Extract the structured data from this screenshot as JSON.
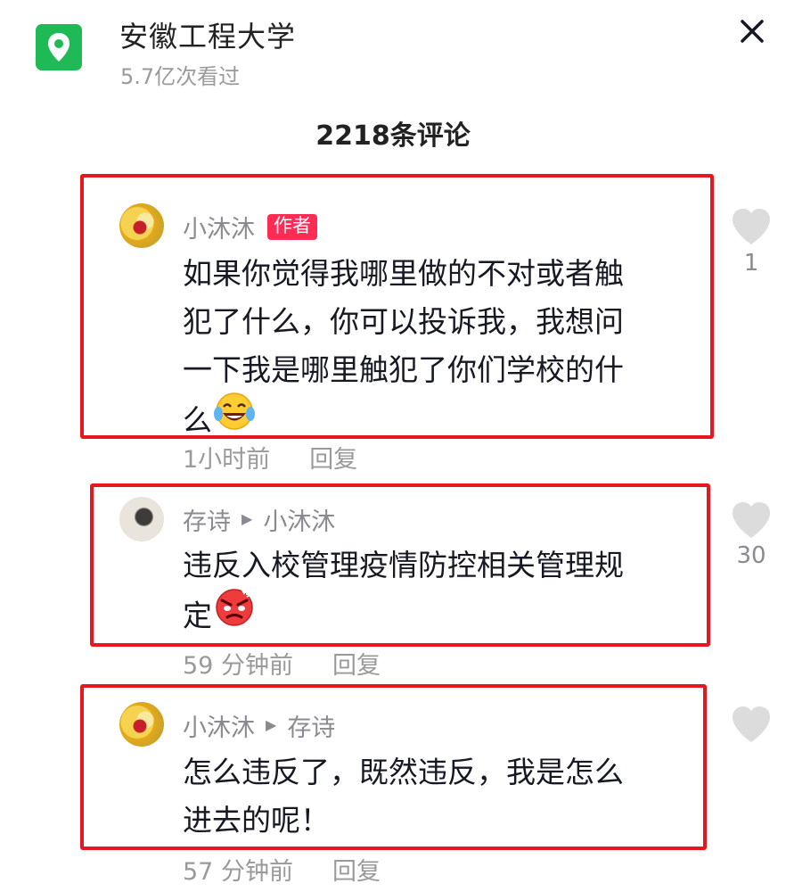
{
  "header": {
    "location_title": "安徽工程大学",
    "views_text": "5.7亿次看过",
    "close_icon": "close-icon",
    "location_icon": "location-pin-icon",
    "accent_color": "#1fb955"
  },
  "comments_header": {
    "count_label": "2218条评论"
  },
  "comments": [
    {
      "author": "小沐沐",
      "badge": "作者",
      "reply_to": "",
      "text_lines": [
        "如果你觉得我哪里做的不对或者触",
        "犯了什么，你可以投诉我，我想问",
        "一下我是哪里触犯了你们学校的什",
        "么"
      ],
      "emoji": "laughing-crying-emoji",
      "time": "1小时前",
      "reply_label": "回复",
      "likes": "1"
    },
    {
      "author": "存诗",
      "badge": "",
      "reply_to": "小沐沐",
      "text_lines": [
        "违反入校管理疫情防控相关管理规",
        "定"
      ],
      "emoji": "angry-face-emoji",
      "time": "59 分钟前",
      "reply_label": "回复",
      "likes": "30"
    },
    {
      "author": "小沐沐",
      "badge": "",
      "reply_to": "存诗",
      "text_lines": [
        "怎么违反了，既然违反，我是怎么",
        "进去的呢！"
      ],
      "emoji": "",
      "time": "57 分钟前",
      "reply_label": "回复",
      "likes": ""
    }
  ],
  "colors": {
    "badge_bg": "#fe2c55",
    "highlight_box": "#e8161f",
    "secondary_text": "#8a8b91"
  }
}
